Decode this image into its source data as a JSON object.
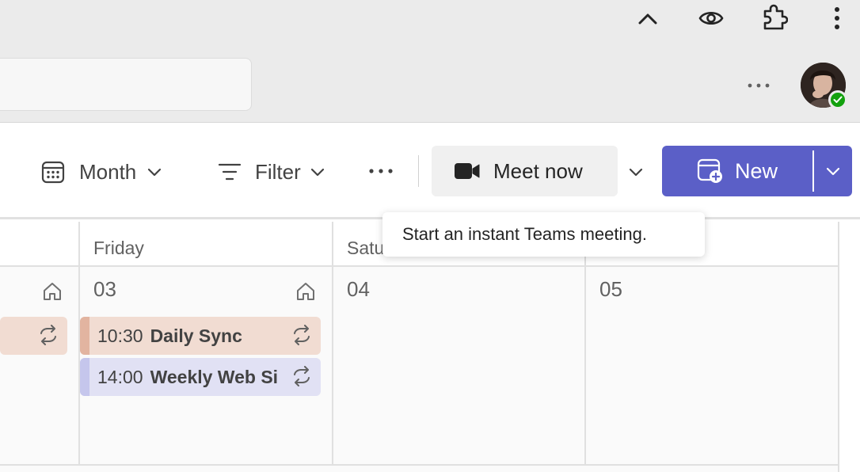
{
  "browser": {
    "icons": [
      "chevron-up-icon",
      "eye-icon",
      "extension-icon",
      "more-vertical-icon",
      "more-horizontal-icon"
    ]
  },
  "toolbar": {
    "view_label": "Month",
    "filter_label": "Filter",
    "meet_now_label": "Meet now",
    "new_label": "New",
    "tooltip": "Start an instant Teams meeting."
  },
  "calendar": {
    "columns": [
      {
        "header": "",
        "day": ""
      },
      {
        "header": "Friday",
        "day": "03"
      },
      {
        "header": "Satu",
        "day": "04"
      },
      {
        "header": "",
        "day": "05"
      }
    ],
    "events": [
      {
        "time": "10:30",
        "title": "Daily Sync"
      },
      {
        "time": "14:00",
        "title": "Weekly Web Si"
      }
    ]
  },
  "colors": {
    "accent": "#5b5fc7",
    "presence": "#13a10e",
    "event_sync_bg": "#f1dcd2",
    "event_sync_bar": "#e2b4a0",
    "event_web_bg": "#e1e1f4",
    "event_web_bar": "#c5c6ec"
  }
}
